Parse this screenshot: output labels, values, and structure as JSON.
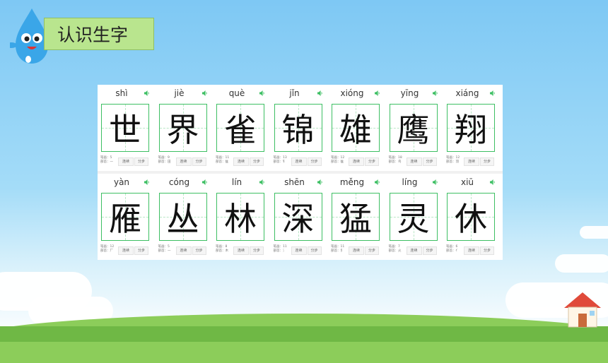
{
  "header": {
    "title": "认识生字"
  },
  "cards": [
    {
      "pinyin": "shì",
      "char": "世",
      "strokes": "5",
      "radical": "一"
    },
    {
      "pinyin": "jiè",
      "char": "界",
      "strokes": "9",
      "radical": "田"
    },
    {
      "pinyin": "què",
      "char": "雀",
      "strokes": "11",
      "radical": "隹"
    },
    {
      "pinyin": "jǐn",
      "char": "锦",
      "strokes": "13",
      "radical": "钅"
    },
    {
      "pinyin": "xióng",
      "char": "雄",
      "strokes": "12",
      "radical": "隹"
    },
    {
      "pinyin": "yīng",
      "char": "鹰",
      "strokes": "18",
      "radical": "鸟"
    },
    {
      "pinyin": "xiáng",
      "char": "翔",
      "strokes": "12",
      "radical": "羽"
    },
    {
      "pinyin": "yàn",
      "char": "雁",
      "strokes": "12",
      "radical": "厂"
    },
    {
      "pinyin": "cóng",
      "char": "丛",
      "strokes": "5",
      "radical": "一"
    },
    {
      "pinyin": "lín",
      "char": "林",
      "strokes": "8",
      "radical": "木"
    },
    {
      "pinyin": "shēn",
      "char": "深",
      "strokes": "11",
      "radical": "氵"
    },
    {
      "pinyin": "měng",
      "char": "猛",
      "strokes": "11",
      "radical": "犭"
    },
    {
      "pinyin": "líng",
      "char": "灵",
      "strokes": "7",
      "radical": "火"
    },
    {
      "pinyin": "xiū",
      "char": "休",
      "strokes": "6",
      "radical": "亻"
    }
  ],
  "labels": {
    "strokes_prefix": "笔画：",
    "radical_prefix": "部首：",
    "play_button": "连续",
    "step_button": "分步"
  },
  "icons": {
    "speaker": "speaker-icon",
    "mascot": "water-drop-mascot",
    "house": "house-icon"
  },
  "colors": {
    "grid": "#3dbf63",
    "title_bg": "#b9e58e",
    "sky": "#7ec8f4"
  }
}
